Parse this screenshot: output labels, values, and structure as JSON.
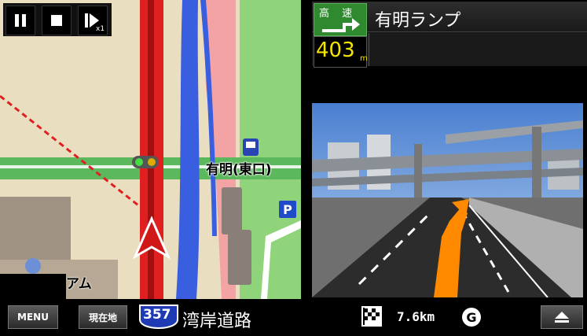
{
  "guide": {
    "highway_label": "高 速",
    "exit_name": "有明ランプ",
    "distance_value": "403",
    "distance_unit": "m"
  },
  "map": {
    "station_label": "有明(東口)",
    "partial_label": "アム",
    "parking_label": "P",
    "controls": [
      "pause-icon",
      "stop-icon",
      "step-icon"
    ],
    "speed_label": "x1"
  },
  "bottom": {
    "menu_label": "MENU",
    "current_location_label": "現在地",
    "route_number": "357",
    "road_name": "湾岸道路",
    "remaining_distance": "7.6km",
    "destination_icon": "checkered-flag-icon",
    "goal_marker": "G",
    "eject_icon": "eject-icon"
  },
  "colors": {
    "highway_green": "#2f8a2f",
    "distance_yellow": "#f5e400",
    "route_red": "#e02020",
    "road_blue": "#3a5ee0",
    "road_pink": "#f3a3a3",
    "route_orange": "#ff8a00"
  }
}
